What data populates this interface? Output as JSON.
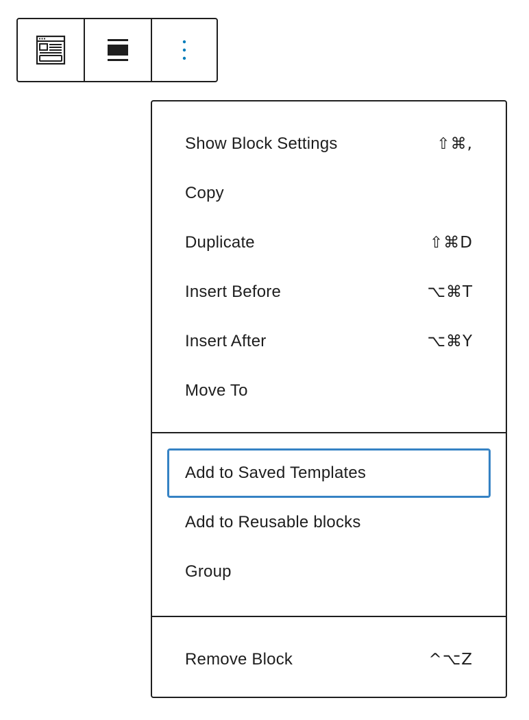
{
  "toolbar": {
    "buttons": [
      {
        "icon": "block-type-layout-icon"
      },
      {
        "icon": "align-wide-icon"
      },
      {
        "icon": "more-vertical-icon",
        "accent": "#007cba"
      }
    ]
  },
  "menu": {
    "groups": [
      {
        "items": [
          {
            "label": "Show Block Settings",
            "shortcut": "⇧⌘,"
          },
          {
            "label": "Copy",
            "shortcut": ""
          },
          {
            "label": "Duplicate",
            "shortcut": "⇧⌘D"
          },
          {
            "label": "Insert Before",
            "shortcut": "⌥⌘T"
          },
          {
            "label": "Insert After",
            "shortcut": "⌥⌘Y"
          },
          {
            "label": "Move To",
            "shortcut": ""
          }
        ]
      },
      {
        "items": [
          {
            "label": "Add to Saved Templates",
            "shortcut": "",
            "focused": true
          },
          {
            "label": "Add to Reusable blocks",
            "shortcut": ""
          },
          {
            "label": "Group",
            "shortcut": ""
          }
        ]
      },
      {
        "items": [
          {
            "label": "Remove Block",
            "shortcut": "^⌥Z"
          }
        ]
      }
    ]
  },
  "colors": {
    "border": "#1e1e1e",
    "focus": "#3582c4",
    "accent": "#007cba",
    "text": "#1e1e1e"
  }
}
